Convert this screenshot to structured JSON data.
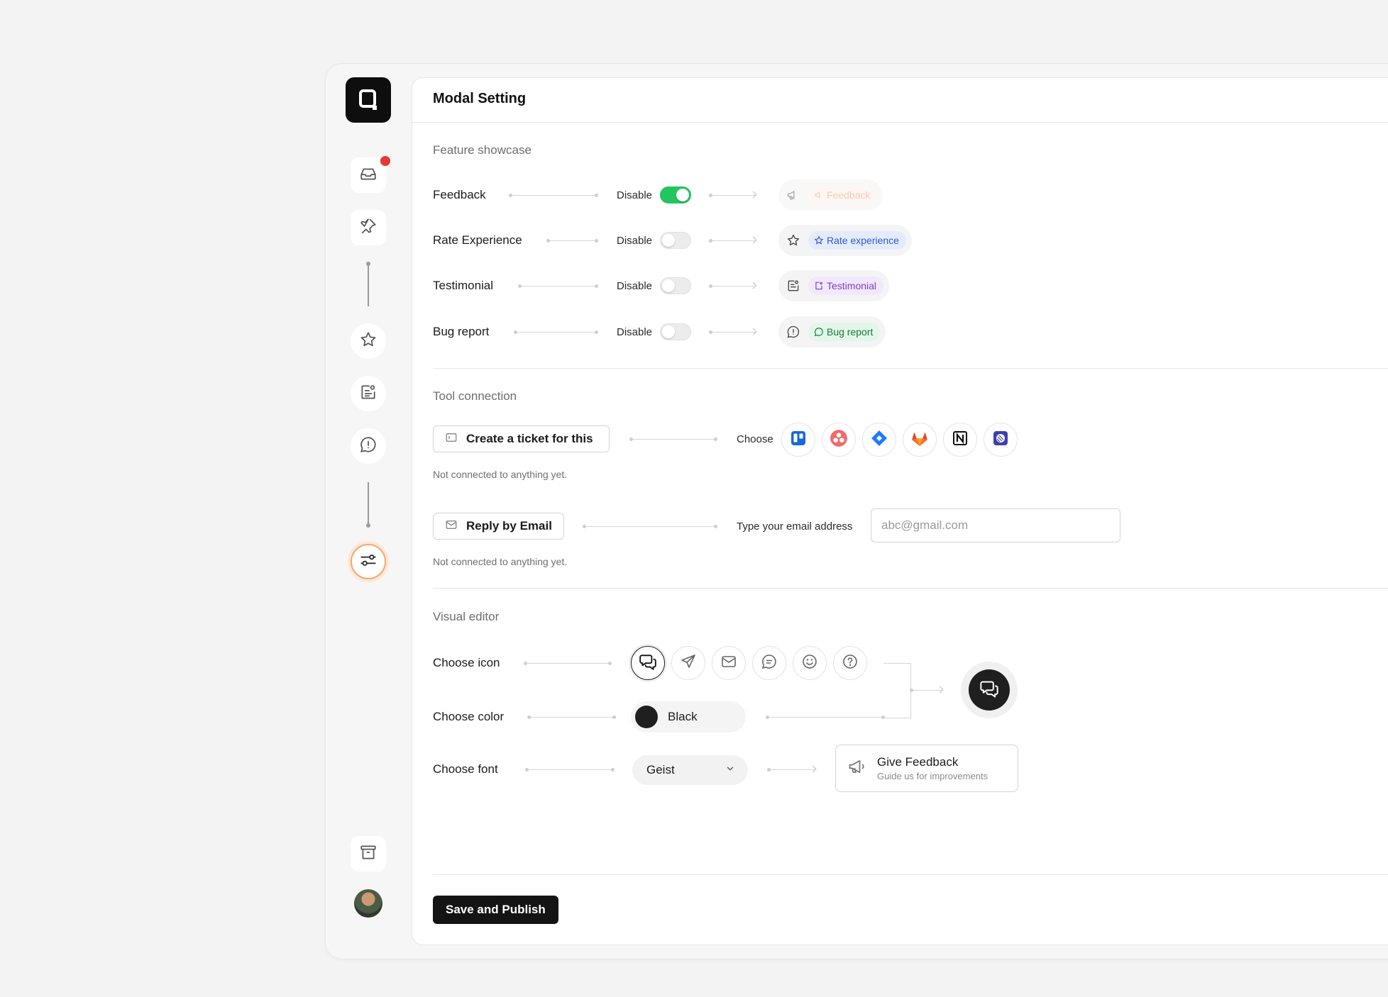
{
  "header": {
    "title": "Modal Setting"
  },
  "feature_showcase": {
    "section_title": "Feature showcase",
    "toggle_label": "Disable",
    "rows": [
      {
        "label": "Feedback",
        "enabled": true,
        "preview_label": "Feedback",
        "preview_icon": "megaphone-icon",
        "preview_color": "#f4a27c",
        "preview_bg": "#fdf1ea"
      },
      {
        "label": "Rate Experience",
        "enabled": false,
        "preview_label": "Rate experience",
        "preview_icon": "star-icon",
        "preview_color": "#2d5bd6",
        "preview_bg": "#e3ebfd"
      },
      {
        "label": "Testimonial",
        "enabled": false,
        "preview_label": "Testimonial",
        "preview_icon": "testimonial-icon",
        "preview_color": "#7b3fd1",
        "preview_bg": "#f1e8fd"
      },
      {
        "label": "Bug report",
        "enabled": false,
        "preview_label": "Bug report",
        "preview_icon": "chat-alert-icon",
        "preview_color": "#177a3e",
        "preview_bg": "#e2f7e9"
      }
    ]
  },
  "tool_connection": {
    "section_title": "Tool connection",
    "ticket_button": "Create a ticket for this",
    "choose_label": "Choose",
    "tools": [
      "trello-icon",
      "asana-icon",
      "jira-icon",
      "gitlab-icon",
      "notion-icon",
      "linear-icon"
    ],
    "ticket_hint": "Not connected to anything yet.",
    "email_button": "Reply by Email",
    "email_label": "Type your email address",
    "email_placeholder": "abc@gmail.com",
    "email_hint": "Not connected to anything yet."
  },
  "visual_editor": {
    "section_title": "Visual editor",
    "icon_label": "Choose icon",
    "icons": [
      "chat-bubbles-icon",
      "send-icon",
      "mail-icon",
      "message-icon",
      "smile-icon",
      "help-icon"
    ],
    "color_label": "Choose color",
    "color_value": "Black",
    "color_hex": "#1f1f1f",
    "font_label": "Choose font",
    "font_value": "Geist",
    "card_title": "Give Feedback",
    "card_subtitle": "Guide us for improvements"
  },
  "footer": {
    "save_label": "Save and Publish"
  },
  "colors": {
    "accent_toggle": "#22c55e",
    "notification": "#e53935",
    "active_ring": "#f6a56f"
  }
}
